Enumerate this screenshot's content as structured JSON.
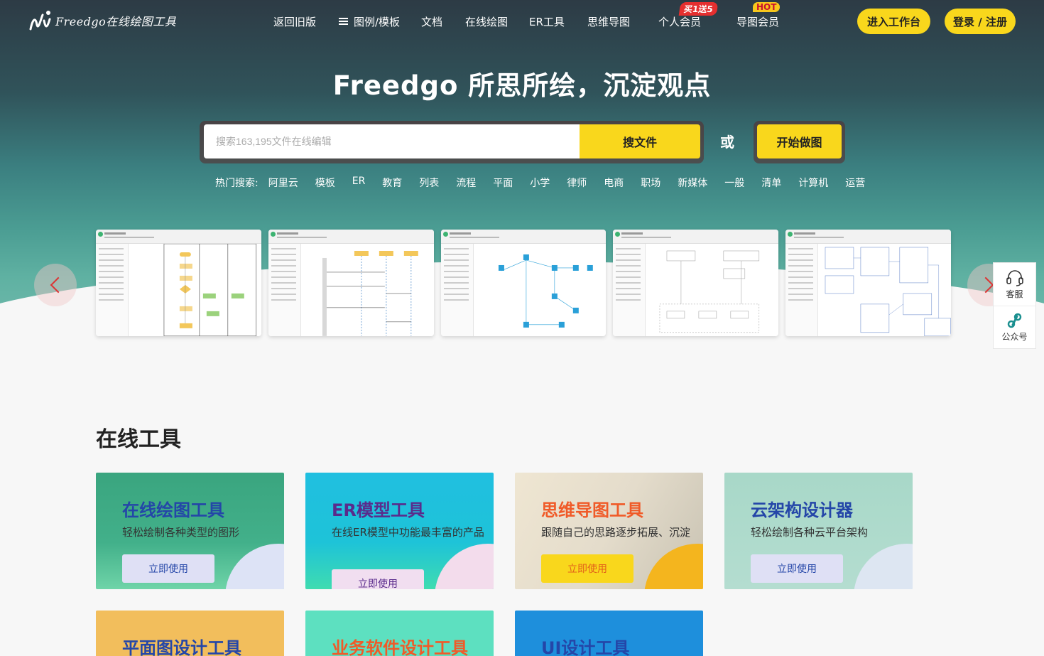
{
  "brand": {
    "logo_text": "Freedgo在线绘图工具"
  },
  "nav": {
    "items": [
      "返回旧版",
      "图例/模板",
      "文档",
      "在线绘图",
      "ER工具",
      "思维导图",
      "个人会员",
      "导图会员"
    ],
    "badge_personal": "买1送5",
    "badge_mindmap": "HOT",
    "workspace_btn": "进入工作台",
    "login_btn": "登录 / 注册"
  },
  "hero": {
    "headline": "Freedgo 所思所绘，沉淀观点",
    "search_placeholder": "搜索163,195文件在线编辑",
    "search_btn": "搜文件",
    "or": "或",
    "start_btn": "开始做图",
    "hot_label": "热门搜索:",
    "hot_tags": [
      "阿里云",
      "模板",
      "ER",
      "教育",
      "列表",
      "流程",
      "平面",
      "小学",
      "律师",
      "电商",
      "职场",
      "新媒体",
      "一般",
      "清单",
      "计算机",
      "运营"
    ]
  },
  "carousel": {
    "thumb_titles": [
      "流程图业务事项",
      "项目报告",
      "Cloud Based Customer Service",
      "Digital Marketing",
      "MySQL示例,用户日数关系"
    ]
  },
  "side_float": {
    "service": "客服",
    "wechat": "公众号"
  },
  "tools": {
    "section_title": "在线工具",
    "cards": [
      {
        "title": "在线绘图工具",
        "desc": "轻松绘制各种类型的图形",
        "btn": "立即使用"
      },
      {
        "title": "ER模型工具",
        "desc": "在线ER模型中功能最丰富的产品",
        "btn": "立即使用"
      },
      {
        "title": "思维导图工具",
        "desc": "跟随自己的思路逐步拓展、沉淀",
        "btn": "立即使用"
      },
      {
        "title": "云架构设计器",
        "desc": "轻松绘制各种云平台架构",
        "btn": "立即使用"
      }
    ],
    "row2": [
      "平面图设计工具",
      "业务软件设计工具",
      "UI设计工具"
    ]
  },
  "colors": {
    "accent_yellow": "#f9d71c",
    "hero_top": "#2d3b45",
    "hero_bottom": "#7cc0b3"
  }
}
